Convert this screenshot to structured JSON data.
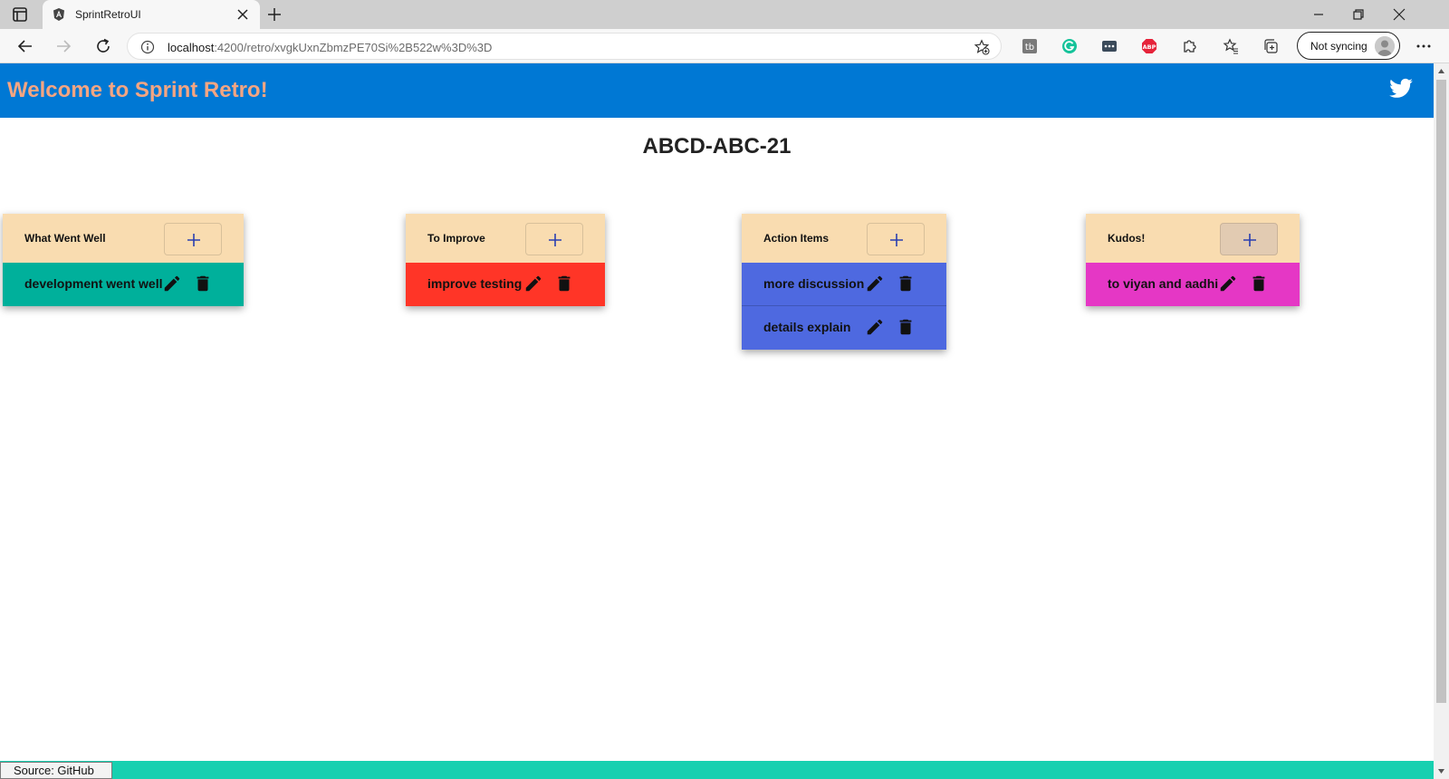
{
  "browser": {
    "tab_title": "SprintRetroUI",
    "url_host": "localhost",
    "url_rest": ":4200/retro/xvgkUxnZbmzPE70Si%2B522w%3D%3D",
    "sync_label": "Not syncing"
  },
  "app": {
    "title": "Welcome to Sprint Retro!",
    "retro_id": "ABCD-ABC-21"
  },
  "columns": [
    {
      "title": "What Went Well",
      "color": "#00b09b",
      "items": [
        "development went well"
      ]
    },
    {
      "title": "To Improve",
      "color": "#ff3527",
      "items": [
        "improve testing"
      ]
    },
    {
      "title": "Action Items",
      "color": "#4e69e0",
      "items": [
        "more discussion",
        "details explain"
      ]
    },
    {
      "title": "Kudos!",
      "color": "#e537c5",
      "items": [
        "to viyan and aadhi"
      ]
    }
  ],
  "colors": {
    "header_bg": "#0078d4",
    "title_fg": "#f4a582",
    "column_head_bg": "#f9dcb0",
    "footer_bg": "#17d0b0"
  },
  "footer": {
    "source": "Source: GitHub"
  }
}
